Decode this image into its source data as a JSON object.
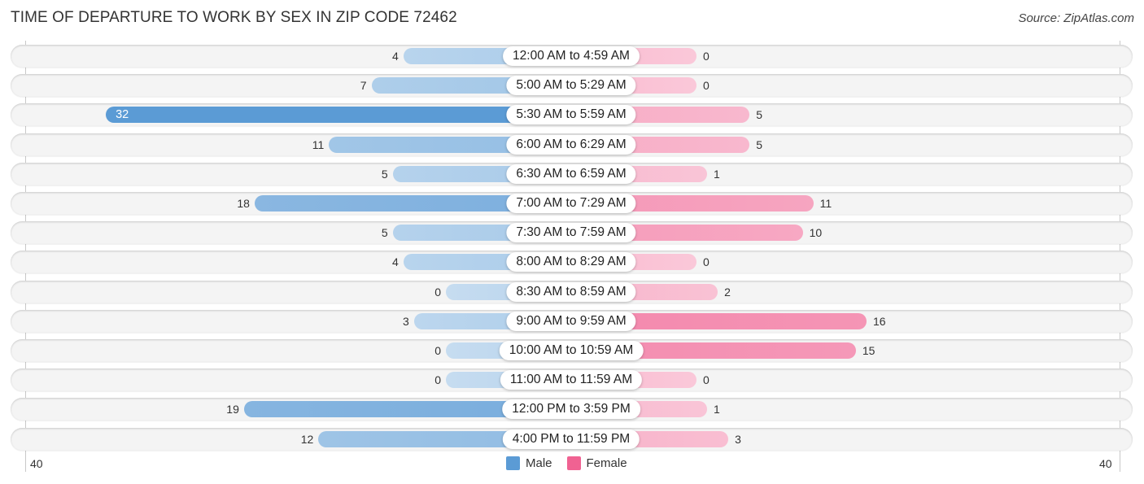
{
  "chart_data": {
    "type": "bar",
    "orientation": "horizontal-diverging",
    "title": "TIME OF DEPARTURE TO WORK BY SEX IN ZIP CODE 72462",
    "source": "Source: ZipAtlas.com",
    "categories": [
      "12:00 AM to 4:59 AM",
      "5:00 AM to 5:29 AM",
      "5:30 AM to 5:59 AM",
      "6:00 AM to 6:29 AM",
      "6:30 AM to 6:59 AM",
      "7:00 AM to 7:29 AM",
      "7:30 AM to 7:59 AM",
      "8:00 AM to 8:29 AM",
      "8:30 AM to 8:59 AM",
      "9:00 AM to 9:59 AM",
      "10:00 AM to 10:59 AM",
      "11:00 AM to 11:59 AM",
      "12:00 PM to 3:59 PM",
      "4:00 PM to 11:59 PM"
    ],
    "series": [
      {
        "name": "Male",
        "color": "#5b9bd5",
        "values": [
          4,
          7,
          32,
          11,
          5,
          18,
          5,
          4,
          0,
          3,
          0,
          0,
          19,
          12
        ]
      },
      {
        "name": "Female",
        "color": "#f06292",
        "values": [
          0,
          0,
          5,
          5,
          1,
          11,
          10,
          0,
          2,
          16,
          15,
          0,
          1,
          3
        ]
      }
    ],
    "axis": {
      "left_label": "40",
      "right_label": "40",
      "max": 40
    },
    "legend": {
      "position": "bottom-center",
      "items": [
        "Male",
        "Female"
      ]
    },
    "grid": false
  }
}
